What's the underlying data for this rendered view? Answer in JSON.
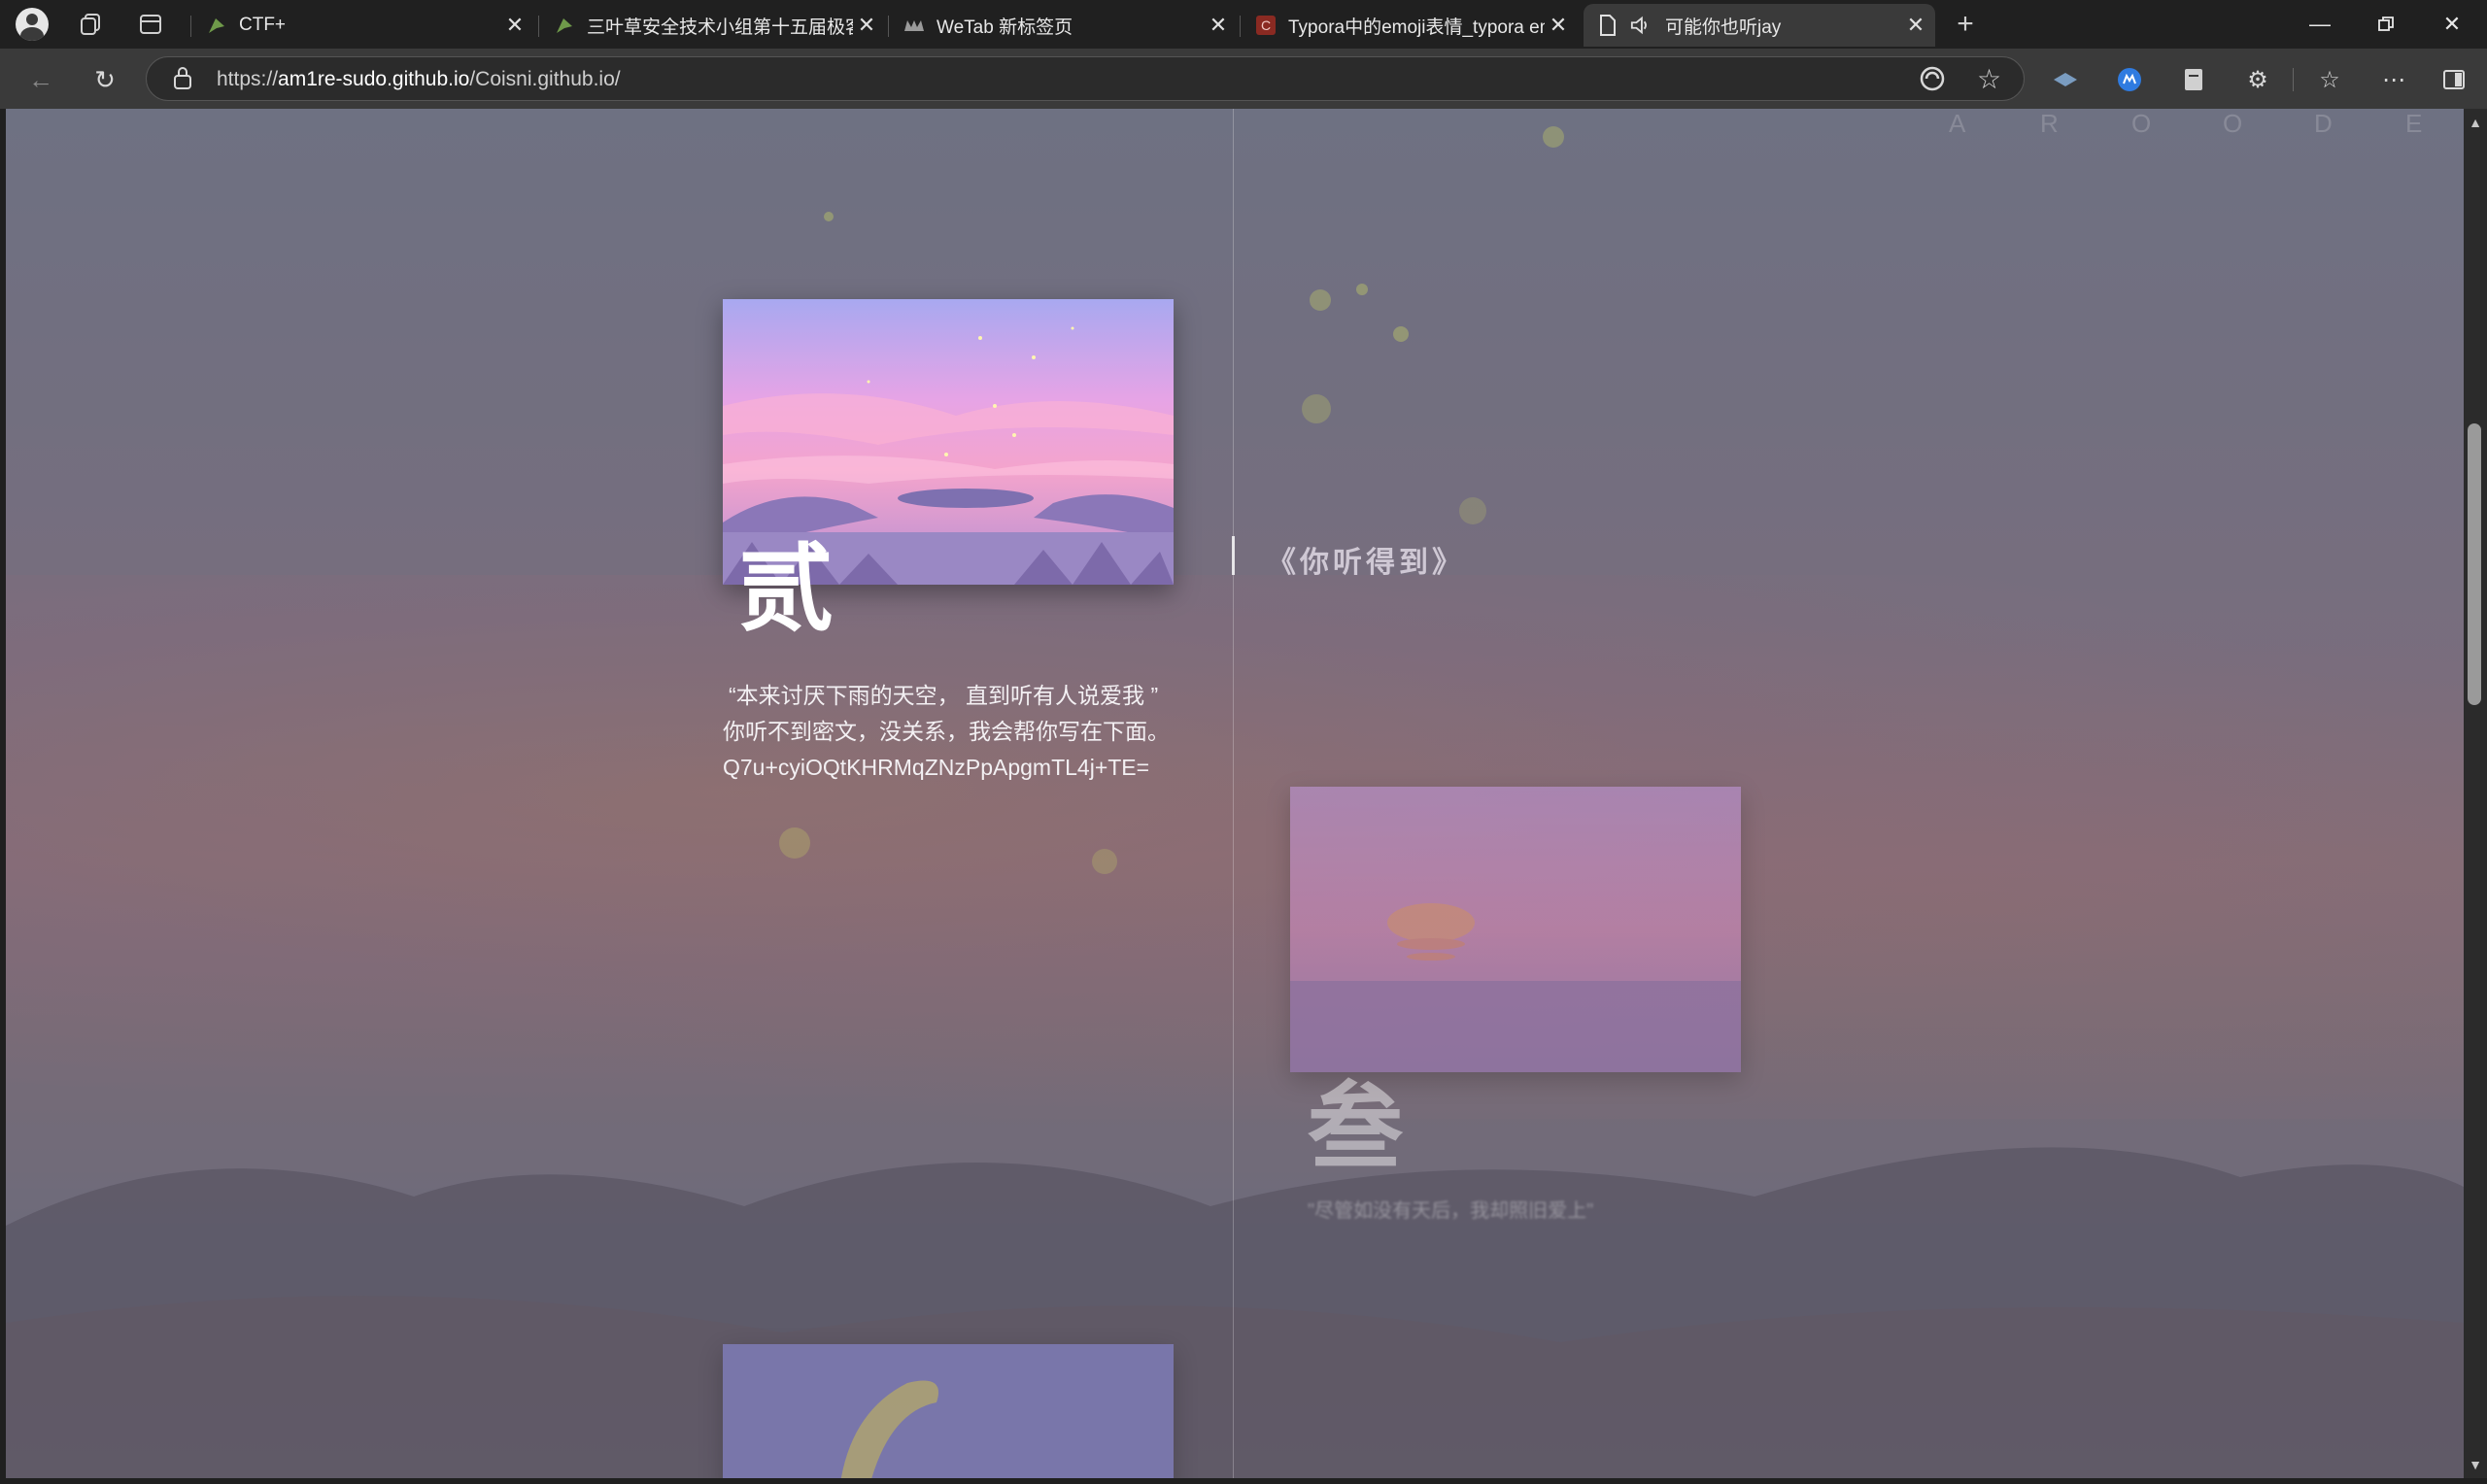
{
  "tabs": [
    {
      "label": "CTF+",
      "icon": "kinetic-figure-icon",
      "active": false
    },
    {
      "label": "三叶草安全技术小组第十五届极客",
      "icon": "kinetic-figure-icon",
      "active": false
    },
    {
      "label": "WeTab 新标签页",
      "icon": "wetab-icon",
      "active": false
    },
    {
      "label": "Typora中的emoji表情_typora emo",
      "icon": "csdn-icon",
      "active": false
    },
    {
      "label": "可能你也听jay",
      "icon": "page-icon",
      "active": true
    }
  ],
  "address_bar": {
    "url_prefix": "https://",
    "url_host": "am1re-sudo.github.io",
    "url_path": "/Coisni.github.io/"
  },
  "page": {
    "watermark_letters": [
      "A",
      "R",
      "O",
      "O",
      "D",
      "E"
    ],
    "card": {
      "number": "贰",
      "line1": "“本来讨厌下雨的天空， 直到听有人说爱我 ”",
      "line2": "你听不到密文，没关系，我会帮你写在下面。",
      "line3": "Q7u+cyiOQtKHRMqZNzPpApgmTL4j+TE="
    },
    "song_title": "《你听得到》",
    "next_card": {
      "number": "叁",
      "text": "\"尽管如没有天后，我却照旧爱上\""
    }
  },
  "colors": {
    "tabstrip_bg": "#202020",
    "active_tab_bg": "#3a3a3a",
    "toolbar_bg": "#3a3a3a",
    "omnibox_bg": "#2b2b2b"
  }
}
